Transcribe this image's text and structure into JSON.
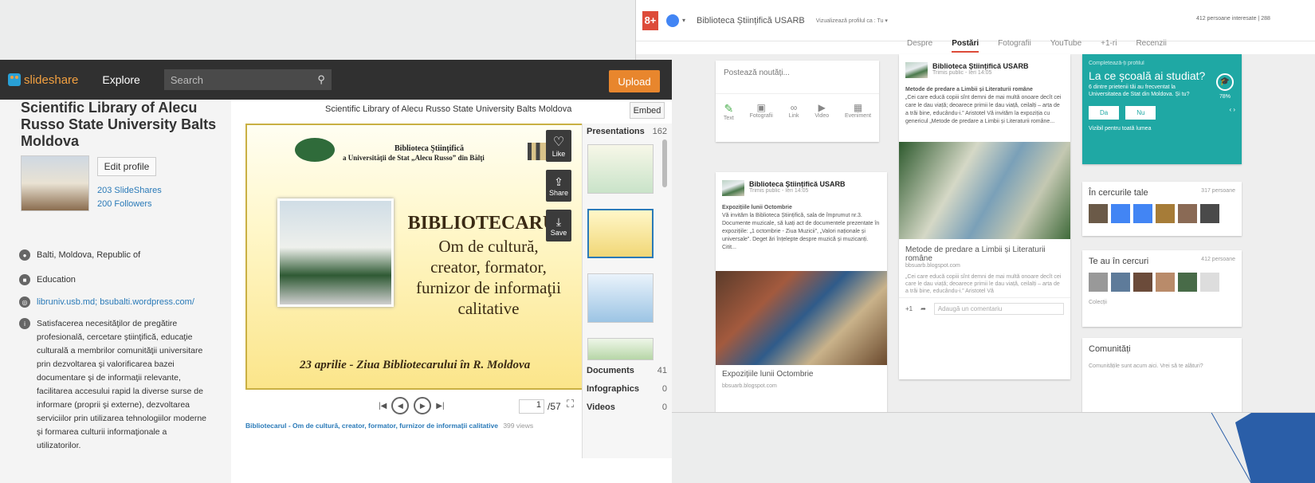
{
  "gplus": {
    "logo": "8+",
    "page_name": "Biblioteca Științifică USARB",
    "view_profile": "Vizualizează profilul ca : Tu ▾",
    "followers": "412 persoane interesate | 288",
    "tabs": [
      "Despre",
      "Postări",
      "Fotografii",
      "YouTube",
      "+1-ri",
      "Recenzii"
    ],
    "compose": {
      "placeholder": "Postează noutăți...",
      "tools": [
        "Text",
        "Fotografii",
        "Link",
        "Video",
        "Eveniment"
      ]
    },
    "post1": {
      "author": "Biblioteca Științifică USARB",
      "meta": "Trimis public - Ieri 14:05",
      "title": "Expozițiile lunii Octombrie",
      "text": "Vă invităm la Biblioteca Științifică, sala de împrumut nr.3. Documente muzicale, să luați act de documentele prezentate în expozițiile: „1 octombrie - Ziua Muzicii”, „Valori naționale și universale”. Deget ări înțelepte despre muzică și muzicanți. Citit...",
      "link": "Expozițiile lunii Octombrie",
      "link_url": "bbsuarb.blogspot.com"
    },
    "post2": {
      "author": "Biblioteca Științifică USARB",
      "meta": "Trimis public - Ieri 14:05",
      "title": "Metode de predare a Limbii și Literaturii române",
      "text": "„Cei care educă copiii sînt demni de mai multă onoare decît cei care le dau viață; deoarece primii le dau viață, ceilalți – arta de a trăi bine, educându-i.” Aristotel Vă invităm la expoziția cu genericul „Metode de predare a Limbii și Literaturii române...",
      "link": "Metode de predare a Limbii și Literaturii române",
      "link_url": "bbsuarb.blogspot.com",
      "link_desc": "„Cei care educă copiii sînt demni de mai multă onoare decît cei care le dau viață; deoarece primii le dau viață, ceilalți – arta de a trăi bine, educându-i.” Aristotel Vă",
      "plus": "+1",
      "comment": "Adaugă un comentariu"
    },
    "profile_card": {
      "header": "Completează-ți profilul",
      "question": "La ce școală ai studiat?",
      "desc": "6 dintre prietenii tăi au frecventat la Universitatea de Stat din Moldova. Și tu?",
      "yes": "Da",
      "no": "Nu",
      "pct": "78%",
      "link": "Vizibil pentru toată lumea"
    },
    "circles": {
      "title": "În cercurile tale",
      "count": "317 persoane"
    },
    "in_circles": {
      "title": "Te au în cercuri",
      "count": "412 persoane",
      "more": "Colecții"
    },
    "community": {
      "title": "Comunități",
      "text": "Comunitățile sunt acum aici. Vrei să te alături?"
    }
  },
  "slideshare": {
    "logo": "slideshare",
    "explore": "Explore",
    "search_placeholder": "Search",
    "upload": "Upload",
    "profile_name": "Scientific Library of Alecu Russo State University Balts Moldova",
    "edit_profile": "Edit profile",
    "slideshares": "203 SlideShares",
    "followers": "200 Followers",
    "location": "Balti, Moldova, Republic of",
    "industry": "Education",
    "website": "libruniv.usb.md; bsubalti.wordpress.com/",
    "about": "Satisfacerea necesităţilor de pregătire profesională, cercetare ştiinţifică, educaţie culturală a membrilor comunităţii universitare prin dezvoltarea şi valorificarea bazei documentare şi de informaţii relevante, facilitarea accesului rapid la diverse surse de informare (proprii şi externe), dezvoltarea serviciilor prin utilizarea tehnologiilor moderne şi formarea culturii informaţionale a utilizatorilor.",
    "player_title": "Scientific Library of Alecu Russo State University Balts Moldova",
    "embed": "Embed",
    "slide": {
      "org_line1": "Biblioteca Ştiinţifică",
      "org_line2": "a Universităţii de Stat „Alecu Russo” din Bălţi",
      "heading": "BIBLIOTECARUL",
      "sub1": "Om de cultură,",
      "sub2": "creator, formator,",
      "sub3": "furnizor de informaţii",
      "sub4": "calitative",
      "date": "23 aprilie - Ziua Bibliotecarului în R. Moldova"
    },
    "actions": {
      "like": "Like",
      "share": "Share",
      "save": "Save"
    },
    "page": "1",
    "page_total": "/57",
    "sections": [
      {
        "label": "Presentations",
        "count": "162"
      },
      {
        "label": "Documents",
        "count": "41"
      },
      {
        "label": "Infographics",
        "count": "0"
      },
      {
        "label": "Videos",
        "count": "0"
      }
    ],
    "caption": "Bibliotecarul - Om de cultură, creator, formator, furnizor de informații calitative",
    "views": "399 views"
  },
  "colors": {
    "gplus_red": "#dd4b39",
    "teal": "#1fa8a4",
    "ss_orange": "#e8862d",
    "ss_dark": "#303030"
  }
}
